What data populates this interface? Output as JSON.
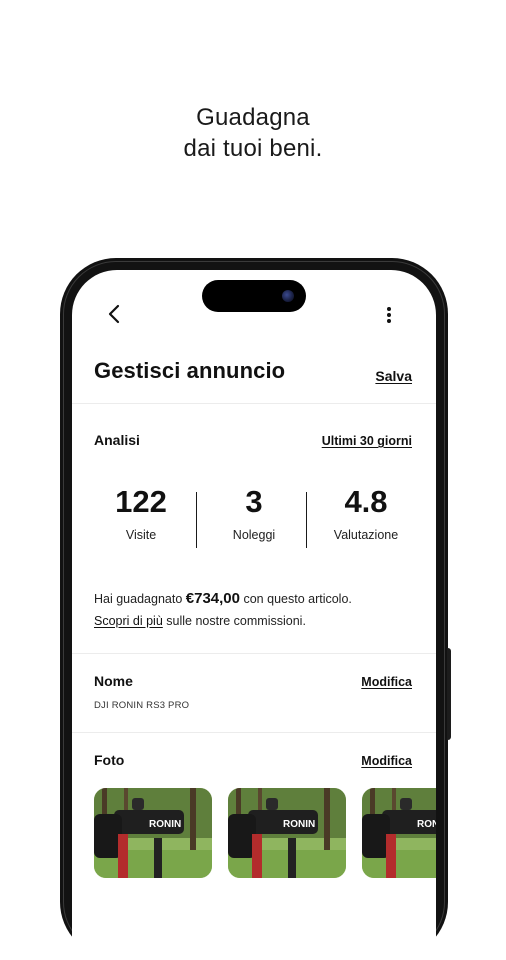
{
  "headline": {
    "line1": "Guadagna",
    "line2": "dai tuoi beni."
  },
  "header": {
    "back_icon": "chevron-left-icon",
    "more_icon": "more-vertical-icon",
    "title": "Gestisci annuncio",
    "save_label": "Salva"
  },
  "analytics": {
    "label": "Analisi",
    "range_label": "Ultimi 30 giorni",
    "stats": [
      {
        "value": "122",
        "label": "Visite"
      },
      {
        "value": "3",
        "label": "Noleggi"
      },
      {
        "value": "4.8",
        "label": "Valutazione"
      }
    ]
  },
  "earnings": {
    "prefix": "Hai guadagnato",
    "amount": "€734,00",
    "suffix": "con questo articolo.",
    "link": "Scopri di più",
    "link_suffix": "sulle nostre commissioni."
  },
  "name_section": {
    "label": "Nome",
    "edit_label": "Modifica",
    "value": "DJI RONIN RS3 PRO"
  },
  "photo_section": {
    "label": "Foto",
    "edit_label": "Modifica",
    "photos": [
      {
        "brand_text": "RONIN"
      },
      {
        "brand_text": "RONIN"
      },
      {
        "brand_text": "RONIN"
      }
    ]
  },
  "colors": {
    "text": "#111111",
    "divider": "#ececec",
    "frame": "#121212",
    "foliage": "#6f9e43"
  }
}
